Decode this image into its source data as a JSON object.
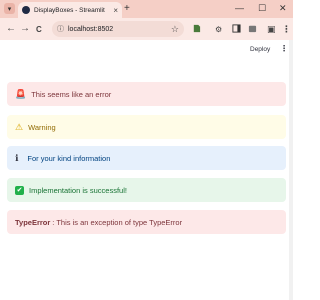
{
  "browser": {
    "tab_title": "DisplayBoxes - Streamlit",
    "tab_close": "×",
    "new_tab": "+",
    "url": "localhost:8502",
    "window_controls": {
      "minimize": "—",
      "maximize": "☐",
      "close": "✕"
    },
    "nav": {
      "back": "←",
      "forward": "→",
      "reload": "C"
    }
  },
  "app": {
    "deploy_label": "Deploy",
    "menu_glyph": "⋮"
  },
  "alerts": {
    "error": {
      "icon": "🚨",
      "text": "This seems like an error"
    },
    "warning": {
      "icon": "⚠",
      "text": "Warning"
    },
    "info": {
      "icon": "ℹ",
      "text": "For your kind information"
    },
    "success": {
      "icon": "✔",
      "text": "Implementation is successful!"
    },
    "exception": {
      "name": "TypeError",
      "text": ": This is an exception of type TypeError"
    }
  },
  "colors": {
    "error_bg": "#fde8e8",
    "warning_bg": "#fffce7",
    "info_bg": "#e6f0fc",
    "success_bg": "#e7f6ea",
    "titlebar": "#f5cfc6"
  }
}
